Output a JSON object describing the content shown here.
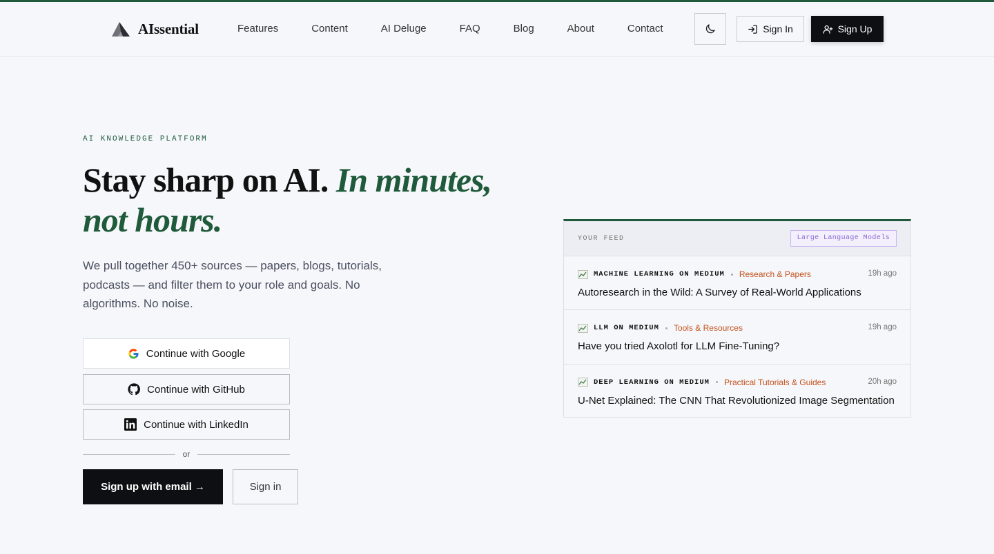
{
  "brand": {
    "name": "AIssential"
  },
  "nav": [
    {
      "label": "Features"
    },
    {
      "label": "Content"
    },
    {
      "label": "AI Deluge"
    },
    {
      "label": "FAQ"
    },
    {
      "label": "Blog"
    },
    {
      "label": "About"
    },
    {
      "label": "Contact"
    }
  ],
  "header": {
    "theme_icon": "moon-icon",
    "signin_label": "Sign In",
    "signup_label": "Sign Up"
  },
  "hero": {
    "eyebrow": "AI KNOWLEDGE PLATFORM",
    "title_plain": "Stay sharp on AI.",
    "title_accent": "In minutes, not hours.",
    "lede": "We pull together 450+ sources — papers, blogs, tutorials, podcasts — and filter them to your role and goals. No algorithms. No noise."
  },
  "auth": {
    "google": "Continue with Google",
    "github": "Continue with GitHub",
    "linkedin": "Continue with LinkedIn",
    "divider": "or",
    "email": "Sign up with email →",
    "signin": "Sign in"
  },
  "feed": {
    "label": "YOUR FEED",
    "tag": "Large Language Models",
    "items": [
      {
        "source": "MACHINE LEARNING ON MEDIUM",
        "category": "Research & Papers",
        "time": "19h ago",
        "title": "Autoresearch in the Wild: A Survey of Real-World Applications"
      },
      {
        "source": "LLM ON MEDIUM",
        "category": "Tools & Resources",
        "time": "19h ago",
        "title": "Have you tried Axolotl for LLM Fine-Tuning?"
      },
      {
        "source": "DEEP LEARNING ON MEDIUM",
        "category": "Practical Tutorials & Guides",
        "time": "20h ago",
        "title": "U-Net Explained: The CNN That Revolutionized Image Segmentation"
      }
    ]
  },
  "colors": {
    "accent_green": "#1f5a3b",
    "category_orange": "#c2501a",
    "tag_purple": "#8a6ad6",
    "dark_button": "#0d0f12"
  }
}
